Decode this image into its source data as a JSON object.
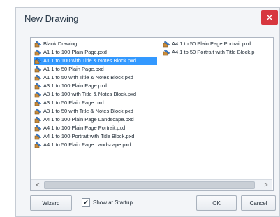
{
  "window": {
    "title": "New Drawing",
    "close_glyph": "✕"
  },
  "list": {
    "column1": [
      "Blank Drawing",
      "A1 1 to 100 Plain Page.pxd",
      "A1 1 to 100 with Title & Notes Block.pxd",
      "A1 1 to 50 Plain Page.pxd",
      "A1 1 to 50 with Title & Notes Block.pxd",
      "A3 1 to 100 Plain Page.pxd",
      "A3 1 to 100 with Title & Notes Block.pxd",
      "A3 1 to 50 Plain Page.pxd",
      "A3 1 to 50 with Title & Notes Block.pxd",
      "A4 1 to 100 Plain Page Landscape.pxd",
      "A4 1 to 100 Plain Page Portrait.pxd",
      "A4 1 to 100 Portrait with Title Block.pxd",
      "A4 1 to 50 Plain Page Landscape.pxd"
    ],
    "column2": [
      "A4 1 to 50 Plain Page Portrait.pxd",
      "A4 1 to 50 Portrait with Title Block.p"
    ],
    "selected": "A1 1 to 100 with Title & Notes Block.pxd",
    "item_icon": "drawing-file-icon"
  },
  "scrollbar": {
    "left_glyph": "<",
    "right_glyph": ">"
  },
  "footer": {
    "wizard_label": "Wizard",
    "show_startup_label": "Show at Startup",
    "show_startup_checked": true,
    "check_glyph": "✔",
    "ok_label": "OK",
    "cancel_label": "Cancel"
  }
}
